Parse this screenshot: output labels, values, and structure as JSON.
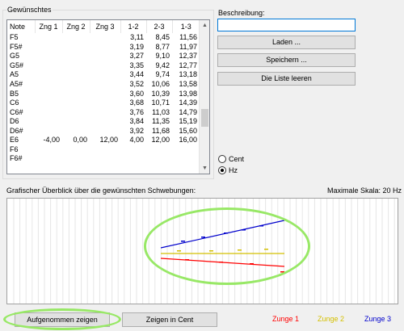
{
  "wishes_group": {
    "title": "Gewünschtes"
  },
  "table": {
    "columns": [
      "Note",
      "Zng 1",
      "Zng 2",
      "Zng 3",
      "1-2",
      "2-3",
      "1-3"
    ],
    "rows": [
      [
        "F5",
        "",
        "",
        "",
        "3,11",
        "8,45",
        "11,56"
      ],
      [
        "F5#",
        "",
        "",
        "",
        "3,19",
        "8,77",
        "11,97"
      ],
      [
        "G5",
        "",
        "",
        "",
        "3,27",
        "9,10",
        "12,37"
      ],
      [
        "G5#",
        "",
        "",
        "",
        "3,35",
        "9,42",
        "12,77"
      ],
      [
        "A5",
        "",
        "",
        "",
        "3,44",
        "9,74",
        "13,18"
      ],
      [
        "A5#",
        "",
        "",
        "",
        "3,52",
        "10,06",
        "13,58"
      ],
      [
        "B5",
        "",
        "",
        "",
        "3,60",
        "10,39",
        "13,98"
      ],
      [
        "C6",
        "",
        "",
        "",
        "3,68",
        "10,71",
        "14,39"
      ],
      [
        "C6#",
        "",
        "",
        "",
        "3,76",
        "11,03",
        "14,79"
      ],
      [
        "D6",
        "",
        "",
        "",
        "3,84",
        "11,35",
        "15,19"
      ],
      [
        "D6#",
        "",
        "",
        "",
        "3,92",
        "11,68",
        "15,60"
      ],
      [
        "E6",
        "-4,00",
        "0,00",
        "12,00",
        "4,00",
        "12,00",
        "16,00"
      ],
      [
        "F6",
        "",
        "",
        "",
        "",
        "",
        ""
      ],
      [
        "F6#",
        "",
        "",
        "",
        "",
        "",
        ""
      ]
    ]
  },
  "scroll": {
    "up_icon": "arrow-up-icon",
    "down_icon": "arrow-down-icon"
  },
  "description": {
    "label": "Beschreibung:",
    "value": ""
  },
  "buttons": {
    "load": "Laden ...",
    "save": "Speichern ...",
    "clear": "Die Liste leeren",
    "show_recorded": "Aufgenommen zeigen",
    "show_cent": "Zeigen in Cent"
  },
  "units": {
    "cent": "Cent",
    "hz": "Hz",
    "selected": "Hz"
  },
  "overview": {
    "title": "Grafischer Überblick über die gewünschten Schwebungen:",
    "max_scale": "Maximale Skala: 20 Hz"
  },
  "legend": [
    {
      "label": "Zunge 1",
      "color": "#ff0000"
    },
    {
      "label": "Zunge 2",
      "color": "#d4c000"
    },
    {
      "label": "Zunge 3",
      "color": "#0000cc"
    }
  ],
  "highlight_color": "#98e866"
}
